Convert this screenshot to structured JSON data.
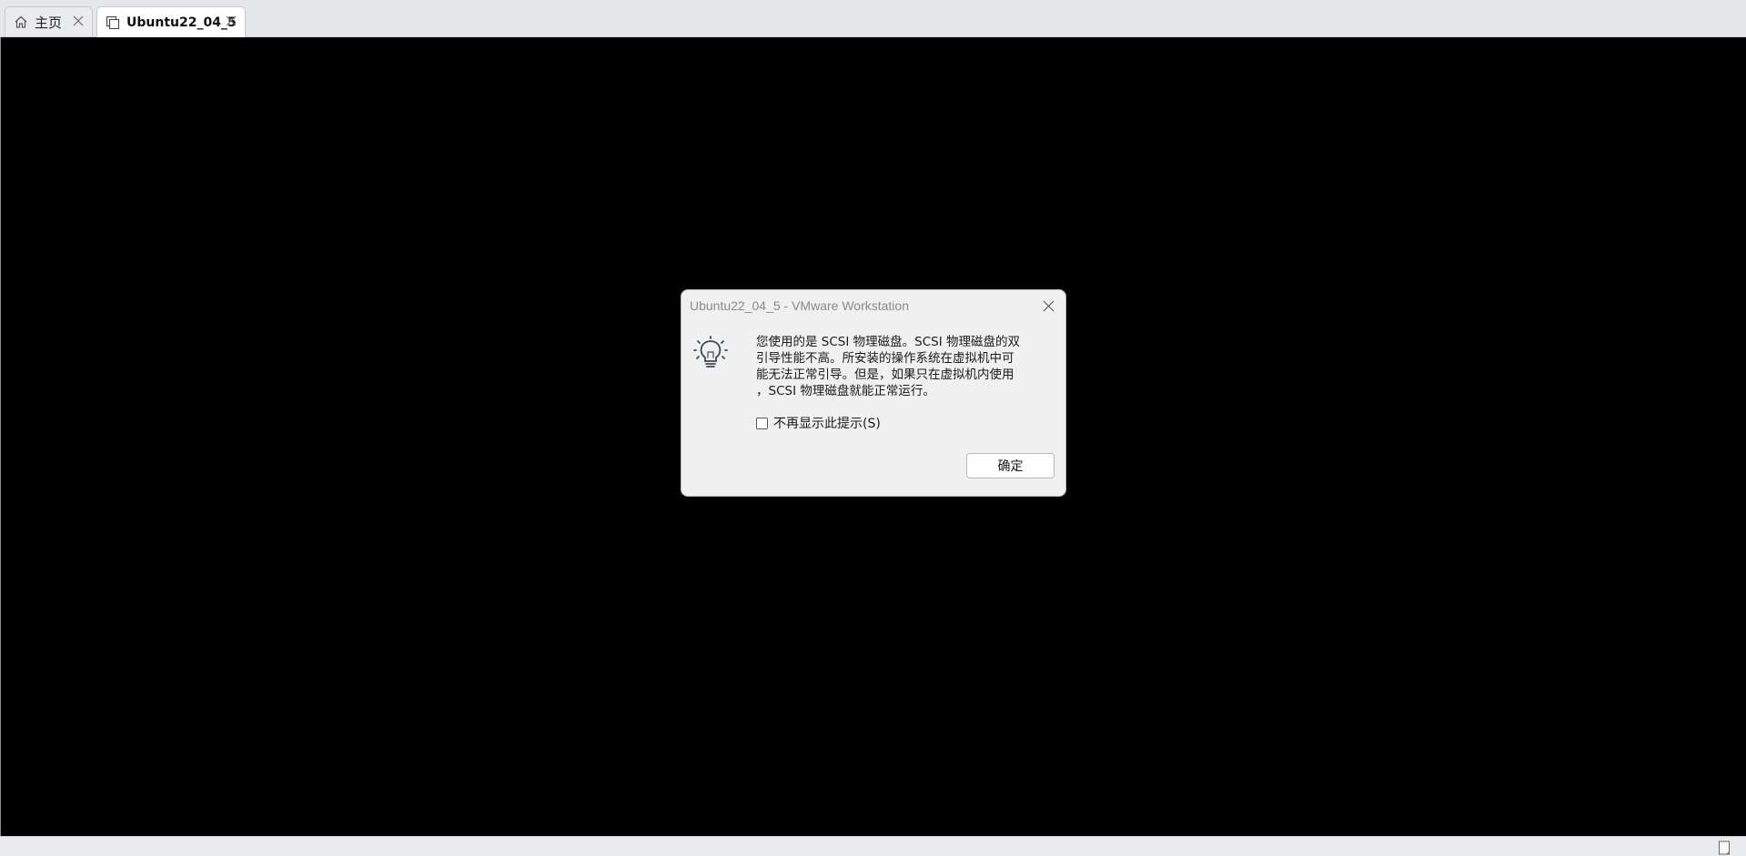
{
  "tabs": [
    {
      "label": "主页",
      "icon": "home-icon",
      "active": false
    },
    {
      "label": "Ubuntu22_04_5",
      "icon": "vm-icon",
      "active": true
    }
  ],
  "dialog": {
    "title": "Ubuntu22_04_5 - VMware Workstation",
    "icon": "lightbulb-icon",
    "message_lines": [
      "您使用的是 SCSI 物理磁盘。SCSI 物理磁盘的双",
      "引导性能不高。所安装的操作系统在虚拟机中可",
      "能无法正常引导。但是，如果只在虚拟机内使用",
      "，SCSI 物理磁盘就能正常运行。"
    ],
    "checkbox_label": "不再显示此提示(S)",
    "checkbox_checked": false,
    "ok_label": "确定"
  },
  "statusbar": {
    "icon": "message-log-icon"
  }
}
